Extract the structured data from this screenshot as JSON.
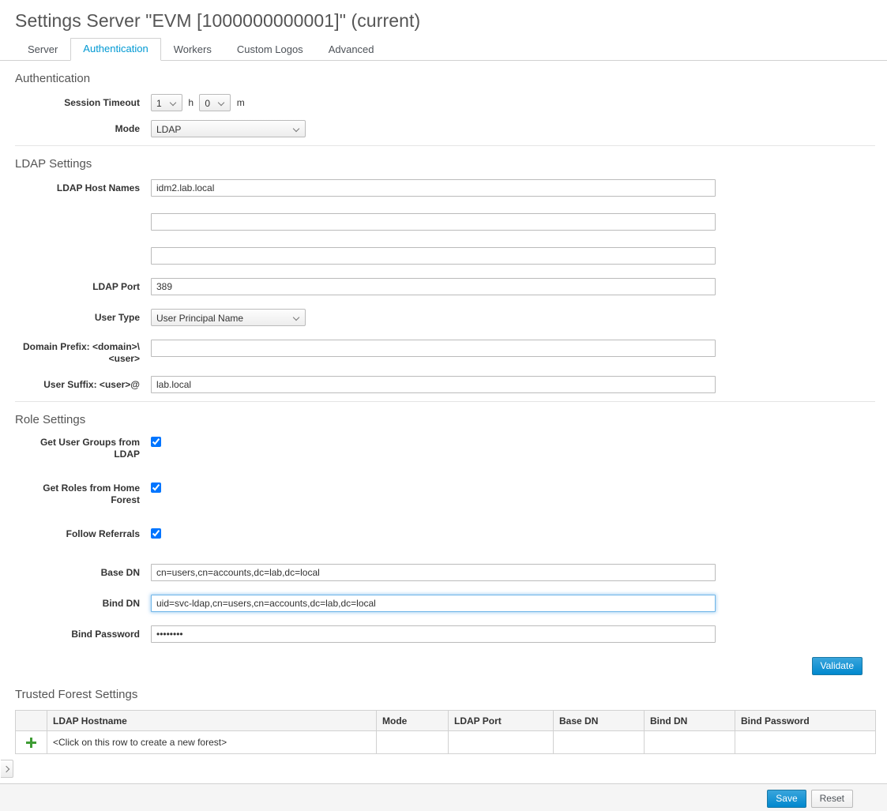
{
  "page": {
    "title": "Settings Server \"EVM [1000000000001]\" (current)"
  },
  "tabs": [
    {
      "label": "Server",
      "active": false
    },
    {
      "label": "Authentication",
      "active": true
    },
    {
      "label": "Workers",
      "active": false
    },
    {
      "label": "Custom Logos",
      "active": false
    },
    {
      "label": "Advanced",
      "active": false
    }
  ],
  "authentication": {
    "section_title": "Authentication",
    "session_timeout": {
      "label": "Session Timeout",
      "hours_value": "1",
      "hours_unit": "h",
      "minutes_value": "0",
      "minutes_unit": "m"
    },
    "mode": {
      "label": "Mode",
      "value": "LDAP"
    }
  },
  "ldap_settings": {
    "section_title": "LDAP Settings",
    "host_names": {
      "label": "LDAP Host Names",
      "value1": "idm2.lab.local",
      "value2": "",
      "value3": ""
    },
    "port": {
      "label": "LDAP Port",
      "value": "389"
    },
    "user_type": {
      "label": "User Type",
      "value": "User Principal Name"
    },
    "domain_prefix": {
      "label_line1": "Domain Prefix: <domain>\\",
      "label_line2": "<user>",
      "value": ""
    },
    "user_suffix": {
      "label": "User Suffix: <user>@",
      "value": "lab.local"
    }
  },
  "role_settings": {
    "section_title": "Role Settings",
    "get_user_groups": {
      "label": "Get User Groups from LDAP",
      "checked": true
    },
    "get_roles_home_forest": {
      "label": "Get Roles from Home Forest",
      "checked": true
    },
    "follow_referrals": {
      "label": "Follow Referrals",
      "checked": true
    },
    "base_dn": {
      "label": "Base DN",
      "value": "cn=users,cn=accounts,dc=lab,dc=local"
    },
    "bind_dn": {
      "label": "Bind DN",
      "value": "uid=svc-ldap,cn=users,cn=accounts,dc=lab,dc=local",
      "focused": true
    },
    "bind_password": {
      "label": "Bind Password",
      "value": "••••••••"
    },
    "validate_button": "Validate"
  },
  "trusted_forest": {
    "section_title": "Trusted Forest Settings",
    "columns": [
      "",
      "LDAP Hostname",
      "Mode",
      "LDAP Port",
      "Base DN",
      "Bind DN",
      "Bind Password"
    ],
    "rows": [
      {
        "add_icon": "plus-icon",
        "hostname": "<Click on this row to create a new forest>",
        "mode": "",
        "port": "",
        "base_dn": "",
        "bind_dn": "",
        "bind_password": ""
      }
    ]
  },
  "footer": {
    "save_label": "Save",
    "reset_label": "Reset"
  },
  "colors": {
    "accent_blue": "#0088ce",
    "tab_active_text": "#0099d3",
    "plus_green": "#3f9c35",
    "border_grey": "#d1d1d1"
  }
}
